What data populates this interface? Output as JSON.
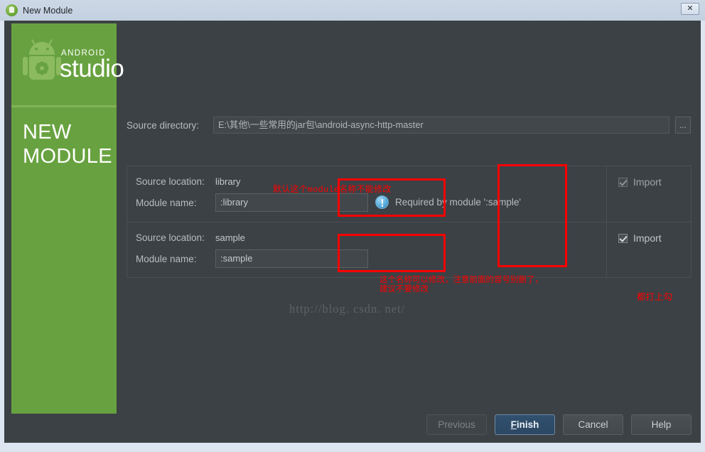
{
  "window": {
    "title": "New Module",
    "icon": "android-studio-icon",
    "close_label": "✕"
  },
  "side_panel": {
    "brand_small": "ANDROID",
    "brand_large": "studio",
    "title_line1": "NEW",
    "title_line2": "MODULE",
    "background_color": "#68a240",
    "divider_color": "#82b257"
  },
  "source_directory": {
    "label": "Source directory:",
    "value": "E:\\其他\\一些常用的jar包\\android-async-http-master",
    "browse_label": "..."
  },
  "modules": {
    "columns": {
      "source_location_label": "Source location:",
      "module_name_label": "Module name:",
      "import_label": "Import"
    },
    "rows": [
      {
        "source_location": "library",
        "module_name": ":library",
        "import_checked": true,
        "import_enabled": false,
        "warning": "Required by module ':sample'"
      },
      {
        "source_location": "sample",
        "module_name": ":sample",
        "import_checked": true,
        "import_enabled": true,
        "warning": ""
      }
    ]
  },
  "watermark": "http://blog. csdn. net/",
  "annotations": {
    "color": "#fe0000",
    "library_note": "默认这个module名称不能修改",
    "sample_note_line1": "这个名称可以修改，注意前面的冒号别删了，",
    "sample_note_line2": "建议不要修改",
    "import_note": "都打上勾"
  },
  "buttons": {
    "previous": "Previous",
    "finish_underlined": "F",
    "finish_rest": "inish",
    "cancel": "Cancel",
    "help": "Help"
  }
}
